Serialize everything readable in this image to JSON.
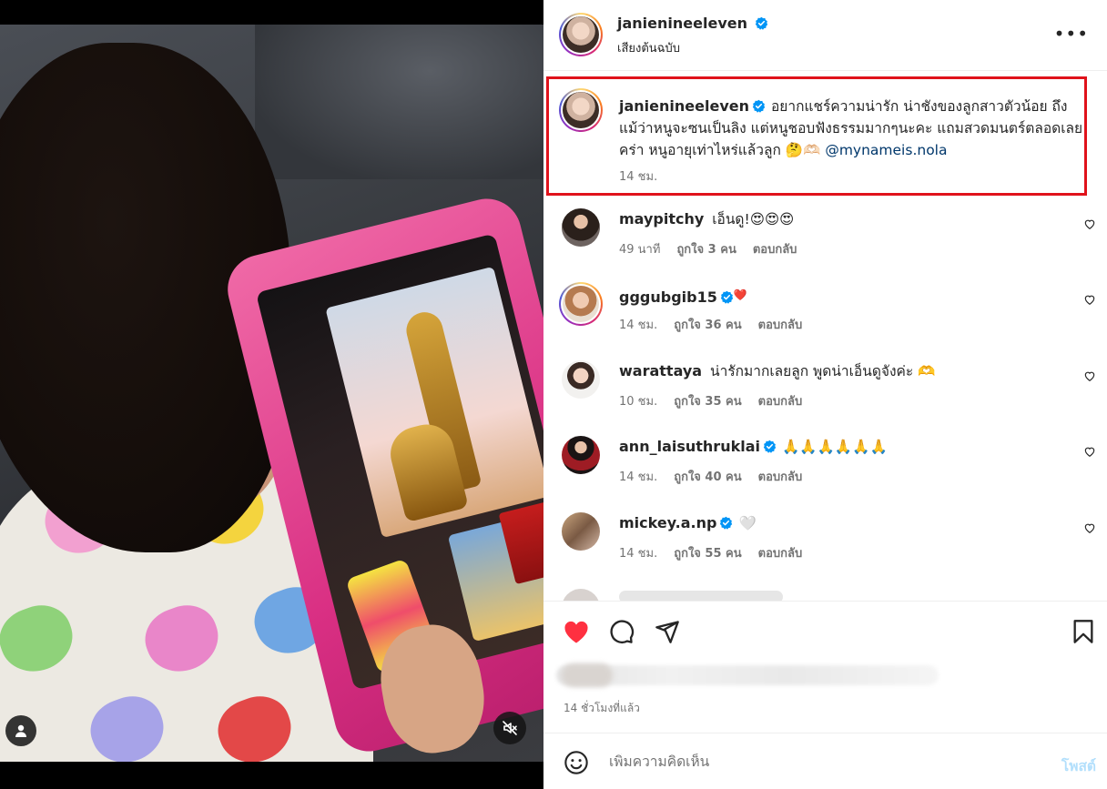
{
  "header": {
    "username": "janienineeleven",
    "audio": "เสียงต้นฉบับ",
    "more": "•••"
  },
  "caption": {
    "username": "janienineeleven",
    "text": "อยากแชร์ความน่ารัก น่าชังของลูกสาวตัวน้อย ถึงแม้ว่าหนูจะซนเป็นลิง แต่หนูชอบฟังธรรมมากๆนะคะ แถมสวดมนตร์ตลอดเลยคร่า หนูอายุเท่าไหร่แล้วลูก 🤔🫶🏻 ",
    "mention": "@mynameis.nola",
    "time": "14 ชม."
  },
  "comments": [
    {
      "username": "maypitchy",
      "verified": false,
      "text": "เอ็นดู!😍😍😍",
      "time": "49 นาที",
      "likes": "ถูกใจ 3 คน",
      "reply": "ตอบกลับ"
    },
    {
      "username": "gggubgib15",
      "verified": true,
      "text": "❤️",
      "time": "14 ชม.",
      "likes": "ถูกใจ 36 คน",
      "reply": "ตอบกลับ"
    },
    {
      "username": "warattaya",
      "verified": false,
      "text": "น่ารักมากเลยลูก พูดน่าเอ็นดูจังค่ะ 🫶",
      "time": "10 ชม.",
      "likes": "ถูกใจ 35 คน",
      "reply": "ตอบกลับ"
    },
    {
      "username": "ann_laisuthruklai",
      "verified": true,
      "text": "🙏🙏🙏🙏🙏🙏",
      "time": "14 ชม.",
      "likes": "ถูกใจ 40 คน",
      "reply": "ตอบกลับ"
    },
    {
      "username": "mickey.a.np",
      "verified": true,
      "text": "🤍",
      "time": "14 ชม.",
      "likes": "ถูกใจ 55 คน",
      "reply": "ตอบกลับ"
    }
  ],
  "actions": {
    "time_ago": "14 ชั่วโมงที่แล้ว"
  },
  "add_comment": {
    "placeholder": "เพิ่มความคิดเห็น",
    "post": "โพสต์"
  },
  "colors": {
    "like_red": "#ff3040",
    "verified_blue": "#0095f6",
    "highlight_red": "#e0121b",
    "post_disabled": "#b2dffc"
  },
  "icons": [
    "verified-badge-icon",
    "more-options-icon",
    "heart-icon",
    "comment-icon",
    "share-icon",
    "save-icon",
    "emoji-icon",
    "user-tag-icon",
    "mute-icon"
  ]
}
